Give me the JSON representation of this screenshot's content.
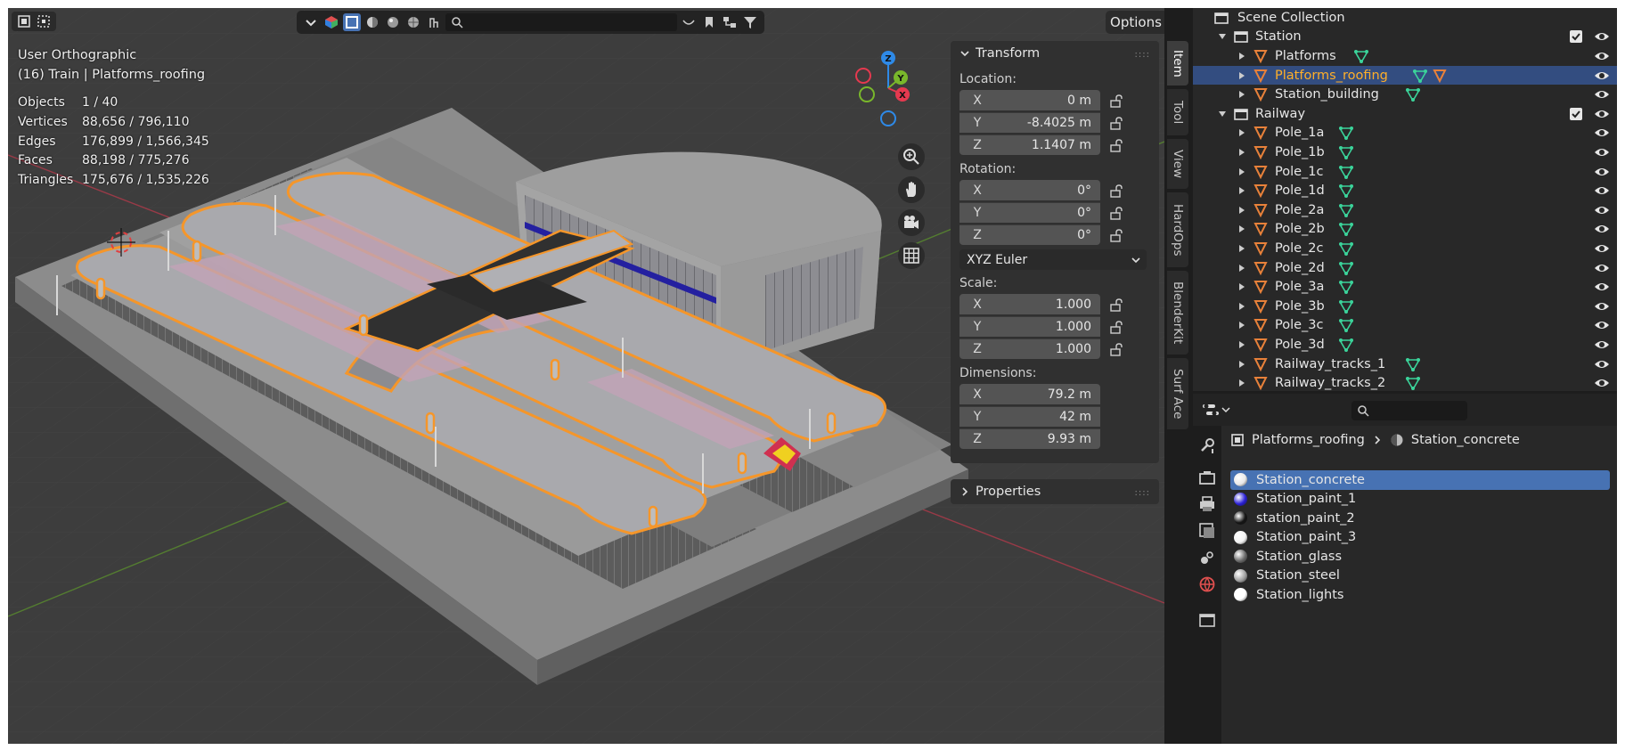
{
  "viewport": {
    "view_name": "User Orthographic",
    "context": "(16) Train | Platforms_roofing",
    "stats": [
      {
        "label": "Objects",
        "value": "1 / 40"
      },
      {
        "label": "Vertices",
        "value": "88,656 / 796,110"
      },
      {
        "label": "Edges",
        "value": "176,899 / 1,566,345"
      },
      {
        "label": "Faces",
        "value": "88,198 / 775,276"
      },
      {
        "label": "Triangles",
        "value": "175,676 / 1,535,226"
      }
    ],
    "options_label": "Options",
    "gizmo": {
      "z": "Z",
      "y": "Y",
      "x": "X"
    }
  },
  "npanel": {
    "transform_title": "Transform",
    "location_label": "Location:",
    "location": [
      {
        "axis": "X",
        "value": "0 m"
      },
      {
        "axis": "Y",
        "value": "-8.4025 m"
      },
      {
        "axis": "Z",
        "value": "1.1407 m"
      }
    ],
    "rotation_label": "Rotation:",
    "rotation": [
      {
        "axis": "X",
        "value": "0°"
      },
      {
        "axis": "Y",
        "value": "0°"
      },
      {
        "axis": "Z",
        "value": "0°"
      }
    ],
    "rotation_mode": "XYZ Euler",
    "scale_label": "Scale:",
    "scale": [
      {
        "axis": "X",
        "value": "1.000"
      },
      {
        "axis": "Y",
        "value": "1.000"
      },
      {
        "axis": "Z",
        "value": "1.000"
      }
    ],
    "dimensions_label": "Dimensions:",
    "dimensions": [
      {
        "axis": "X",
        "value": "79.2 m"
      },
      {
        "axis": "Y",
        "value": "42 m"
      },
      {
        "axis": "Z",
        "value": "9.93 m"
      }
    ],
    "properties_title": "Properties",
    "tabs": [
      "Item",
      "Tool",
      "View",
      "HardOps",
      "BlenderKit",
      "Surf Ace"
    ]
  },
  "outliner": {
    "root": "Scene Collection",
    "rows": [
      {
        "name": "Station",
        "type": "collection",
        "level": 1,
        "expanded": true,
        "check": true
      },
      {
        "name": "Platforms",
        "type": "mesh",
        "level": 2,
        "mods": [
          "mesh"
        ]
      },
      {
        "name": "Platforms_roofing",
        "type": "mesh",
        "level": 2,
        "mods": [
          "mesh",
          "mesh-orange"
        ],
        "selected": true
      },
      {
        "name": "Station_building",
        "type": "mesh",
        "level": 2,
        "mods": [
          "mesh"
        ]
      },
      {
        "name": "Railway",
        "type": "collection",
        "level": 1,
        "expanded": true,
        "check": true
      },
      {
        "name": "Pole_1a",
        "type": "mesh",
        "level": 2,
        "mods": [
          "mesh"
        ]
      },
      {
        "name": "Pole_1b",
        "type": "mesh",
        "level": 2,
        "mods": [
          "mesh"
        ]
      },
      {
        "name": "Pole_1c",
        "type": "mesh",
        "level": 2,
        "mods": [
          "mesh"
        ]
      },
      {
        "name": "Pole_1d",
        "type": "mesh",
        "level": 2,
        "mods": [
          "mesh"
        ]
      },
      {
        "name": "Pole_2a",
        "type": "mesh",
        "level": 2,
        "mods": [
          "mesh"
        ]
      },
      {
        "name": "Pole_2b",
        "type": "mesh",
        "level": 2,
        "mods": [
          "mesh"
        ]
      },
      {
        "name": "Pole_2c",
        "type": "mesh",
        "level": 2,
        "mods": [
          "mesh"
        ]
      },
      {
        "name": "Pole_2d",
        "type": "mesh",
        "level": 2,
        "mods": [
          "mesh"
        ]
      },
      {
        "name": "Pole_3a",
        "type": "mesh",
        "level": 2,
        "mods": [
          "mesh"
        ]
      },
      {
        "name": "Pole_3b",
        "type": "mesh",
        "level": 2,
        "mods": [
          "mesh"
        ]
      },
      {
        "name": "Pole_3c",
        "type": "mesh",
        "level": 2,
        "mods": [
          "mesh"
        ]
      },
      {
        "name": "Pole_3d",
        "type": "mesh",
        "level": 2,
        "mods": [
          "mesh"
        ]
      },
      {
        "name": "Railway_tracks_1",
        "type": "mesh",
        "level": 2,
        "mods": [
          "mesh"
        ]
      },
      {
        "name": "Railway_tracks_2",
        "type": "mesh",
        "level": 2,
        "mods": [
          "mesh"
        ]
      }
    ]
  },
  "properties": {
    "breadcrumb_object": "Platforms_roofing",
    "breadcrumb_material": "Station_concrete",
    "materials": [
      {
        "name": "Station_concrete",
        "color": "#e8e8e8",
        "selected": true
      },
      {
        "name": "Station_paint_1",
        "color": "#2a1fd6"
      },
      {
        "name": "station_paint_2",
        "color": "#151515"
      },
      {
        "name": "Station_paint_3",
        "color": "#f2f2f2"
      },
      {
        "name": "Station_glass",
        "color": "#6a6a6a"
      },
      {
        "name": "Station_steel",
        "color": "#a0a0a0"
      },
      {
        "name": "Station_lights",
        "color": "#ffffff"
      }
    ]
  },
  "colors": {
    "selection_blue": "#4772b3",
    "outline_orange": "#f5962a",
    "outliner_selected_text": "#ffaf29",
    "mesh_icon_orange": "#e8813a",
    "modifier_green": "#3bd39a",
    "axis_x": "#e5394f",
    "axis_y": "#79b72b",
    "axis_z": "#2e8ae8"
  }
}
